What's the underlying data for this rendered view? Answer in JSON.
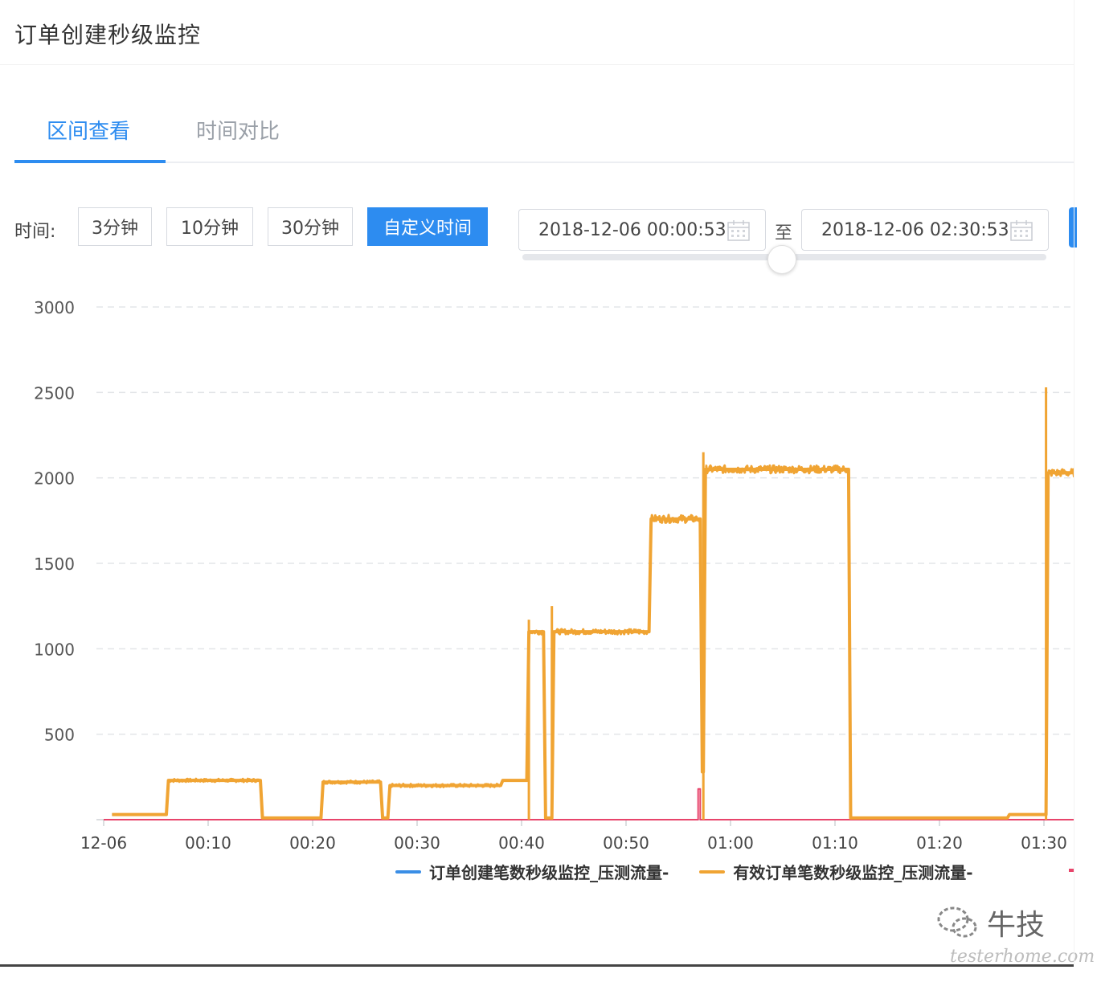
{
  "page": {
    "title": "订单创建秒级监控"
  },
  "tabs": [
    {
      "label": "区间查看",
      "active": true
    },
    {
      "label": "时间对比",
      "active": false
    }
  ],
  "filters": {
    "time_label": "时间:",
    "buttons": [
      {
        "label": "3分钟",
        "active": false
      },
      {
        "label": "10分钟",
        "active": false
      },
      {
        "label": "30分钟",
        "active": false
      },
      {
        "label": "自定义时间",
        "active": true
      }
    ],
    "start_value": "2018-12-06 00:00:53",
    "to_label": "至",
    "end_value": "2018-12-06 02:30:53",
    "slider_level": 0.5
  },
  "chart_data": {
    "type": "line",
    "x_axis": {
      "unit": "minutes since 00:00 on 12-06",
      "range": [
        0,
        160
      ],
      "ticks": [
        {
          "value": 0,
          "label": "12-06"
        },
        {
          "value": 10,
          "label": "00:10"
        },
        {
          "value": 20,
          "label": "00:20"
        },
        {
          "value": 30,
          "label": "00:30"
        },
        {
          "value": 40,
          "label": "00:40"
        },
        {
          "value": 50,
          "label": "00:50"
        },
        {
          "value": 60,
          "label": "01:00"
        },
        {
          "value": 70,
          "label": "01:10"
        },
        {
          "value": 80,
          "label": "01:20"
        },
        {
          "value": 90,
          "label": "01:30"
        }
      ]
    },
    "y_axis": {
      "range": [
        0,
        3000
      ],
      "ticks": [
        500,
        1000,
        1500,
        2000,
        2500,
        3000
      ],
      "grid": true
    },
    "legend_position": "bottom",
    "series": [
      {
        "name": "订单创建笔数秒级监控_压测流量-",
        "color": "#3a8ee6",
        "x": [
          0.8,
          6,
          6.2,
          15,
          15.2,
          20.8,
          21,
          26.5,
          26.7,
          27.2,
          27.4,
          38,
          38.2,
          40.5,
          40.7,
          42.1,
          42.3,
          42.9,
          43.1,
          52.2,
          52.4,
          57.1,
          57.3,
          57.4,
          57.6,
          71.3,
          71.5,
          86.5,
          86.7,
          90.2,
          90.4,
          93
        ],
        "y": [
          30,
          30,
          230,
          230,
          10,
          10,
          220,
          220,
          10,
          10,
          200,
          200,
          230,
          230,
          1100,
          1100,
          10,
          10,
          1100,
          1100,
          1760,
          1760,
          280,
          280,
          2050,
          2050,
          10,
          10,
          30,
          30,
          2030,
          2030
        ]
      },
      {
        "name": "有效订单笔数秒级监控_压测流量-",
        "color": "#f0a433",
        "x": [
          0.8,
          6,
          6.2,
          15,
          15.2,
          20.8,
          21,
          26.5,
          26.7,
          27.2,
          27.4,
          38,
          38.2,
          40.5,
          40.7,
          42.1,
          42.3,
          42.9,
          43.1,
          52.2,
          52.4,
          57.1,
          57.3,
          57.4,
          57.6,
          71.3,
          71.5,
          86.5,
          86.7,
          90.2,
          90.4,
          93
        ],
        "y": [
          30,
          30,
          230,
          230,
          10,
          10,
          220,
          220,
          10,
          10,
          200,
          200,
          230,
          230,
          1100,
          1100,
          10,
          10,
          1100,
          1100,
          1760,
          1760,
          280,
          280,
          2050,
          2050,
          10,
          10,
          30,
          30,
          2030,
          2030
        ]
      },
      {
        "name": "",
        "color": "#e8456b",
        "x": [
          0,
          56.9,
          56.9,
          57.1,
          57.1,
          93
        ],
        "y": [
          0,
          0,
          180,
          180,
          0,
          0
        ]
      }
    ]
  },
  "watermark": {
    "brand": "牛技",
    "url": "testerhome.com"
  }
}
